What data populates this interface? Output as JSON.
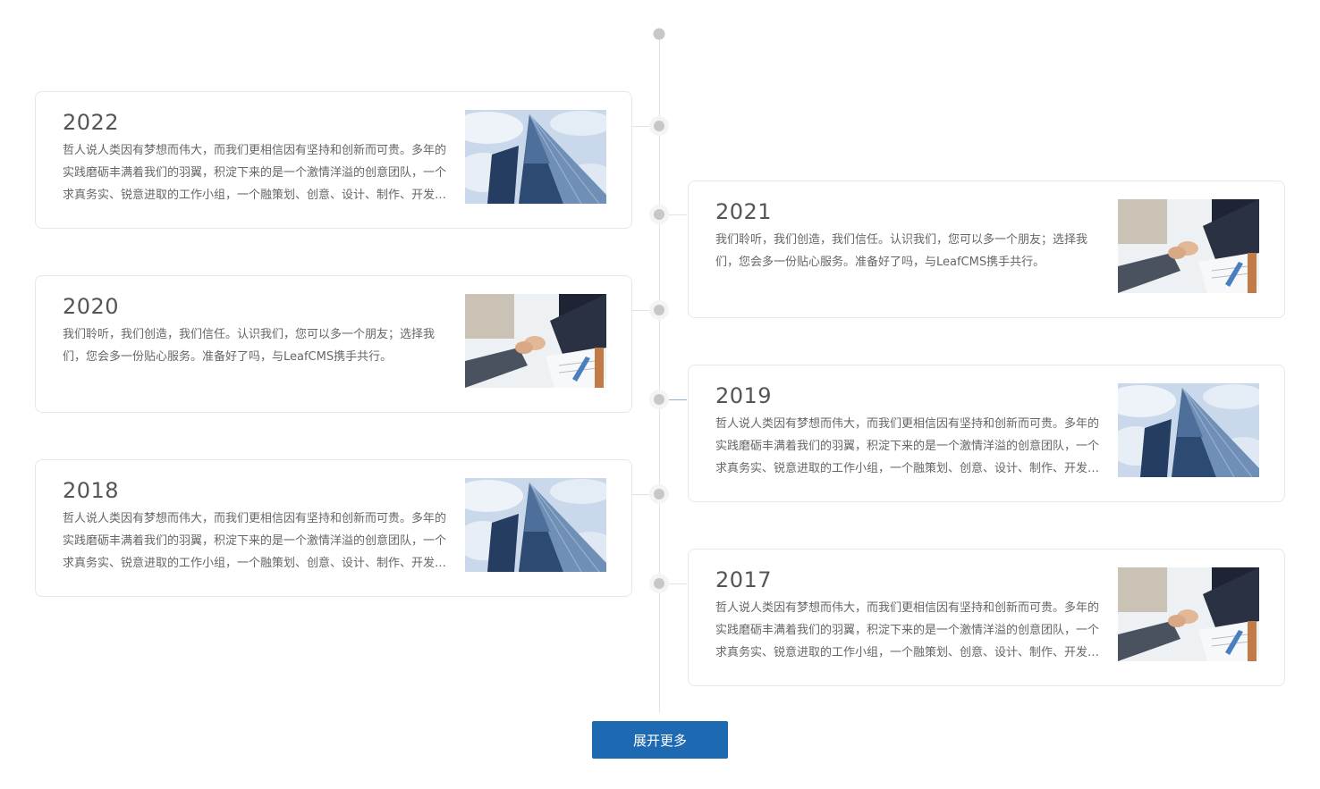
{
  "timeline": {
    "items": [
      {
        "year": "2022",
        "text": "哲人说人类因有梦想而伟大，而我们更相信因有坚持和创新而可贵。多年的实践磨砺丰满着我们的羽翼，积淀下来的是一个激情洋溢的创意团队，一个求真务实、锐意进取的工作小组，一个融策划、创意、设计、制作、开发、推广于一体的专业团队。",
        "image": "skyscraper"
      },
      {
        "year": "2021",
        "text": "我们聆听，我们创造，我们信任。认识我们，您可以多一个朋友；选择我们，您会多一份贴心服务。准备好了吗，与LeafCMS携手共行。",
        "image": "handshake"
      },
      {
        "year": "2020",
        "text": "我们聆听，我们创造，我们信任。认识我们，您可以多一个朋友；选择我们，您会多一份贴心服务。准备好了吗，与LeafCMS携手共行。",
        "image": "handshake"
      },
      {
        "year": "2019",
        "text": "哲人说人类因有梦想而伟大，而我们更相信因有坚持和创新而可贵。多年的实践磨砺丰满着我们的羽翼，积淀下来的是一个激情洋溢的创意团队，一个求真务实、锐意进取的工作小组，一个融策划、创意、设计、制作、开发、推广于一体的专业团队。",
        "image": "skyscraper"
      },
      {
        "year": "2018",
        "text": "哲人说人类因有梦想而伟大，而我们更相信因有坚持和创新而可贵。多年的实践磨砺丰满着我们的羽翼，积淀下来的是一个激情洋溢的创意团队，一个求真务实、锐意进取的工作小组，一个融策划、创意、设计、制作、开发、推广于一体的专业团队。",
        "image": "skyscraper"
      },
      {
        "year": "2017",
        "text": "哲人说人类因有梦想而伟大，而我们更相信因有坚持和创新而可贵。多年的实践磨砺丰满着我们的羽翼，积淀下来的是一个激情洋溢的创意团队，一个求真务实、锐意进取的工作小组，一个融策划、创意、设计、制作、开发、推广于一体的专业团队。",
        "image": "handshake"
      }
    ]
  },
  "more_button": {
    "label": "展开更多"
  },
  "colors": {
    "accent": "#1d6ab3",
    "line": "#e3e3e3",
    "dot": "#c7c7c7"
  }
}
